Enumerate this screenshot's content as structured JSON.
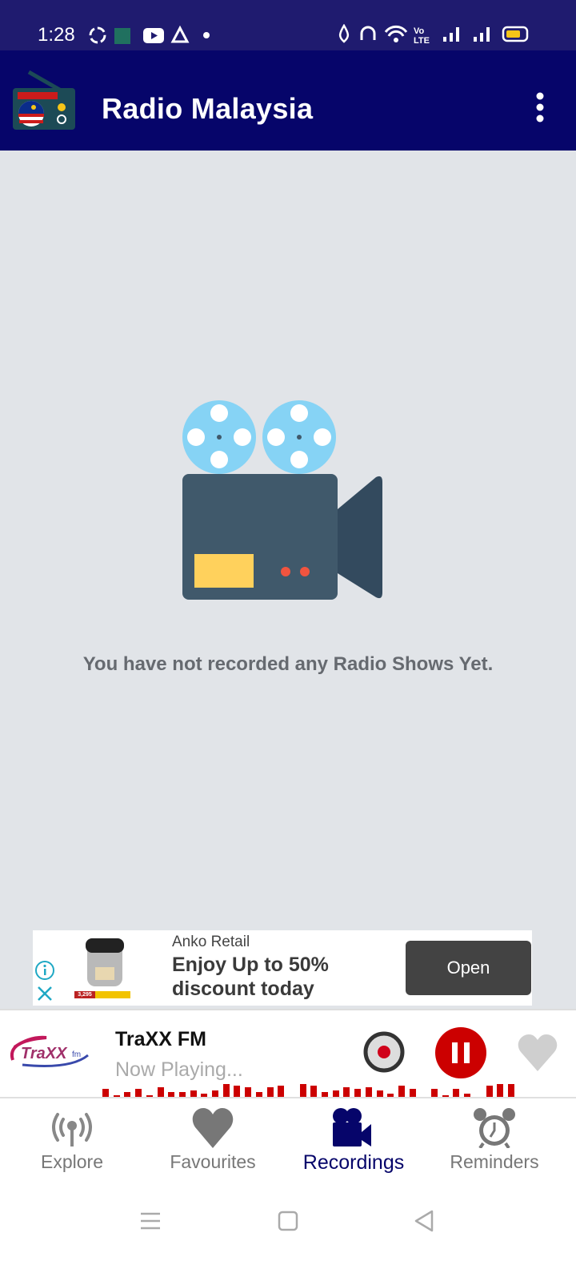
{
  "status_bar": {
    "time": "1:28",
    "battery_color": "#f5c518"
  },
  "app_bar": {
    "title": "Radio Malaysia",
    "menu_icon": "more-vert-icon"
  },
  "empty_state": {
    "icon": "movie-camera-icon",
    "message": "You have not recorded any Radio Shows Yet."
  },
  "ad": {
    "advertiser": "Anko Retail",
    "headline": "Enjoy Up to 50% discount today",
    "cta": "Open",
    "price_tag": "3,295"
  },
  "player": {
    "station": "TraXX FM",
    "logo_text": "TraXX fm",
    "status": "Now Playing...",
    "accent": "#cc0000"
  },
  "bottom_nav": {
    "items": [
      {
        "label": "Explore",
        "icon": "antenna-icon"
      },
      {
        "label": "Favourites",
        "icon": "heart-icon"
      },
      {
        "label": "Recordings",
        "icon": "video-camera-icon",
        "active": true
      },
      {
        "label": "Reminders",
        "icon": "alarm-clock-icon"
      }
    ]
  }
}
